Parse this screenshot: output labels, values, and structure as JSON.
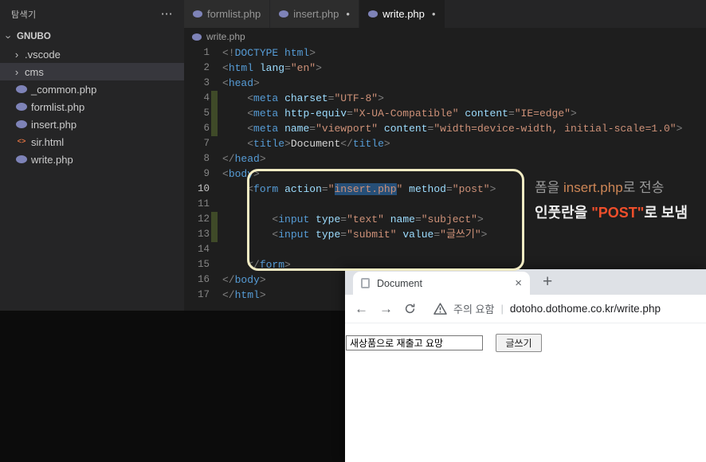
{
  "vscode": {
    "sidebar": {
      "title": "탐색기",
      "root": "GNUBO",
      "folders": [
        {
          "label": ".vscode"
        },
        {
          "label": "cms"
        }
      ],
      "files": [
        {
          "label": "_common.php",
          "icon": "php-icon"
        },
        {
          "label": "formlist.php",
          "icon": "php-icon"
        },
        {
          "label": "insert.php",
          "icon": "php-icon"
        },
        {
          "label": "sir.html",
          "icon": "html-icon"
        },
        {
          "label": "write.php",
          "icon": "php-icon"
        }
      ]
    },
    "tabs": [
      {
        "label": "formlist.php",
        "modified": false,
        "active": false
      },
      {
        "label": "insert.php",
        "modified": true,
        "active": false
      },
      {
        "label": "write.php",
        "modified": true,
        "active": true
      }
    ],
    "breadcrumb": "write.php"
  },
  "editor": {
    "lines": [
      {
        "n": 1,
        "tokens": [
          [
            "p",
            "<!"
          ],
          [
            "tag",
            "DOCTYPE html"
          ],
          [
            "p",
            ">"
          ]
        ]
      },
      {
        "n": 2,
        "tokens": [
          [
            "p",
            "<"
          ],
          [
            "tag",
            "html"
          ],
          [
            "t",
            " "
          ],
          [
            "attr",
            "lang"
          ],
          [
            "p",
            "="
          ],
          [
            "str",
            "\"en\""
          ],
          [
            "p",
            ">"
          ]
        ]
      },
      {
        "n": 3,
        "tokens": [
          [
            "p",
            "<"
          ],
          [
            "tag",
            "head"
          ],
          [
            "p",
            ">"
          ]
        ]
      },
      {
        "n": 4,
        "git": true,
        "tokens": [
          [
            "t",
            "    "
          ],
          [
            "p",
            "<"
          ],
          [
            "tag",
            "meta"
          ],
          [
            "t",
            " "
          ],
          [
            "attr",
            "charset"
          ],
          [
            "p",
            "="
          ],
          [
            "str",
            "\"UTF-8\""
          ],
          [
            "p",
            ">"
          ]
        ]
      },
      {
        "n": 5,
        "git": true,
        "tokens": [
          [
            "t",
            "    "
          ],
          [
            "p",
            "<"
          ],
          [
            "tag",
            "meta"
          ],
          [
            "t",
            " "
          ],
          [
            "attr",
            "http-equiv"
          ],
          [
            "p",
            "="
          ],
          [
            "str",
            "\"X-UA-Compatible\""
          ],
          [
            "t",
            " "
          ],
          [
            "attr",
            "content"
          ],
          [
            "p",
            "="
          ],
          [
            "str",
            "\"IE=edge\""
          ],
          [
            "p",
            ">"
          ]
        ]
      },
      {
        "n": 6,
        "git": true,
        "tokens": [
          [
            "t",
            "    "
          ],
          [
            "p",
            "<"
          ],
          [
            "tag",
            "meta"
          ],
          [
            "t",
            " "
          ],
          [
            "attr",
            "name"
          ],
          [
            "p",
            "="
          ],
          [
            "str",
            "\"viewport\""
          ],
          [
            "t",
            " "
          ],
          [
            "attr",
            "content"
          ],
          [
            "p",
            "="
          ],
          [
            "str",
            "\"width=device-width, initial-scale=1.0\""
          ],
          [
            "p",
            ">"
          ]
        ]
      },
      {
        "n": 7,
        "tokens": [
          [
            "t",
            "    "
          ],
          [
            "p",
            "<"
          ],
          [
            "tag",
            "title"
          ],
          [
            "p",
            ">"
          ],
          [
            "t",
            "Document"
          ],
          [
            "p",
            "</"
          ],
          [
            "tag",
            "title"
          ],
          [
            "p",
            ">"
          ]
        ]
      },
      {
        "n": 8,
        "tokens": [
          [
            "p",
            "</"
          ],
          [
            "tag",
            "head"
          ],
          [
            "p",
            ">"
          ]
        ]
      },
      {
        "n": 9,
        "tokens": [
          [
            "p",
            "<"
          ],
          [
            "tag",
            "body"
          ],
          [
            "p",
            ">"
          ]
        ]
      },
      {
        "n": 10,
        "active": true,
        "tokens": [
          [
            "t",
            "    "
          ],
          [
            "p",
            "<"
          ],
          [
            "tag",
            "form"
          ],
          [
            "t",
            " "
          ],
          [
            "attr",
            "action"
          ],
          [
            "p",
            "="
          ],
          [
            "str",
            "\""
          ],
          [
            "sel",
            "insert.php"
          ],
          [
            "str",
            "\""
          ],
          [
            "t",
            " "
          ],
          [
            "attr",
            "method"
          ],
          [
            "p",
            "="
          ],
          [
            "str",
            "\"post\""
          ],
          [
            "p",
            ">"
          ]
        ]
      },
      {
        "n": 11,
        "guide": true,
        "tokens": []
      },
      {
        "n": 12,
        "git": true,
        "guide": true,
        "tokens": [
          [
            "t",
            "        "
          ],
          [
            "p",
            "<"
          ],
          [
            "tag",
            "input"
          ],
          [
            "t",
            " "
          ],
          [
            "attr",
            "type"
          ],
          [
            "p",
            "="
          ],
          [
            "str",
            "\"text\""
          ],
          [
            "t",
            " "
          ],
          [
            "attr",
            "name"
          ],
          [
            "p",
            "="
          ],
          [
            "str",
            "\"subject\""
          ],
          [
            "p",
            ">"
          ]
        ]
      },
      {
        "n": 13,
        "git": true,
        "guide": true,
        "tokens": [
          [
            "t",
            "        "
          ],
          [
            "p",
            "<"
          ],
          [
            "tag",
            "input"
          ],
          [
            "t",
            " "
          ],
          [
            "attr",
            "type"
          ],
          [
            "p",
            "="
          ],
          [
            "str",
            "\"submit\""
          ],
          [
            "t",
            " "
          ],
          [
            "attr",
            "value"
          ],
          [
            "p",
            "="
          ],
          [
            "str",
            "\"글쓰기\""
          ],
          [
            "p",
            ">"
          ]
        ]
      },
      {
        "n": 14,
        "guide": true,
        "tokens": []
      },
      {
        "n": 15,
        "tokens": [
          [
            "t",
            "    "
          ],
          [
            "p",
            "</"
          ],
          [
            "tag",
            "form"
          ],
          [
            "p",
            ">"
          ]
        ]
      },
      {
        "n": 16,
        "tokens": [
          [
            "p",
            "</"
          ],
          [
            "tag",
            "body"
          ],
          [
            "p",
            ">"
          ]
        ]
      },
      {
        "n": 17,
        "tokens": [
          [
            "p",
            "</"
          ],
          [
            "tag",
            "html"
          ],
          [
            "p",
            ">"
          ]
        ]
      }
    ]
  },
  "annotation": {
    "line1": [
      {
        "text": "폼을 ",
        "color": "#9a9a9a"
      },
      {
        "text": "insert.php",
        "color": "#cd8656"
      },
      {
        "text": "로 전송",
        "color": "#9a9a9a"
      }
    ],
    "line2": [
      {
        "text": "인풋란을 ",
        "color": "#ededed"
      },
      {
        "text": "\"POST\"",
        "color": "#ee4e2b"
      },
      {
        "text": "로 보냄",
        "color": "#ededed"
      }
    ]
  },
  "browser": {
    "tab_title": "Document",
    "security_label": "주의 요함",
    "url": "dotoho.dothome.co.kr/write.php",
    "page": {
      "input_value": "새상품으로 재출고 요망",
      "button_label": "글쓰기"
    }
  },
  "icons": {
    "ellipsis": "⋯",
    "chevron": "›",
    "modified_dot": "●",
    "tab_close": "×",
    "new_tab": "+",
    "back": "←",
    "forward": "→",
    "divider": "|",
    "html_glyph": "<>"
  },
  "colors": {
    "selection": "#264f78",
    "tag": "#569cd6",
    "attribute": "#9cdcfe",
    "string": "#ce9178",
    "callout_border": "#f1ebc3",
    "php_brand": "#7e83b8",
    "git_added": "#3f4a28"
  }
}
